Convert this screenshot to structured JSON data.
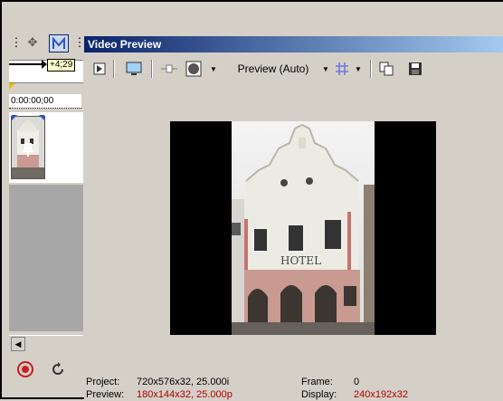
{
  "timeline": {
    "offset": "+4;29",
    "cursor_time": "0:00:00;00"
  },
  "preview": {
    "title": "Video Preview",
    "toolbar": {
      "preview_quality": "Preview (Auto)"
    },
    "status": {
      "project_label": "Project:",
      "project_value": "720x576x32, 25.000i",
      "preview_label": "Preview:",
      "preview_value": "180x144x32, 25.000p",
      "frame_label": "Frame:",
      "frame_value": "0",
      "display_label": "Display:",
      "display_value": "240x192x32"
    }
  },
  "image": {
    "sign_text": "HOTEL"
  },
  "colors": {
    "titlebar_start": "#0a246a",
    "titlebar_end": "#a6caf0",
    "status_red": "#b00000"
  }
}
